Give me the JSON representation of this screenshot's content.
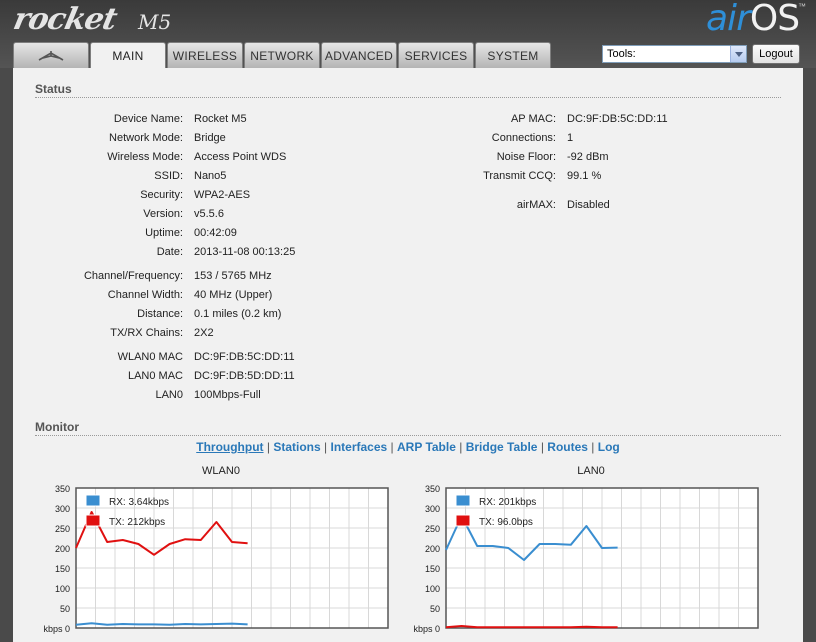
{
  "header": {
    "brand": "rocket",
    "model": "M5",
    "os_logo_a": "air",
    "os_logo_b": "OS",
    "os_tm": "™"
  },
  "tabs": [
    {
      "label": ""
    },
    {
      "label": "MAIN"
    },
    {
      "label": "WIRELESS"
    },
    {
      "label": "NETWORK"
    },
    {
      "label": "ADVANCED"
    },
    {
      "label": "SERVICES"
    },
    {
      "label": "SYSTEM"
    }
  ],
  "tools": {
    "selected": "Tools:"
  },
  "logout_label": "Logout",
  "status": {
    "title": "Status",
    "left": [
      {
        "label": "Device Name:",
        "value": "Rocket M5"
      },
      {
        "label": "Network Mode:",
        "value": "Bridge"
      },
      {
        "label": "Wireless Mode:",
        "value": "Access Point WDS"
      },
      {
        "label": "SSID:",
        "value": "Nano5"
      },
      {
        "label": "Security:",
        "value": "WPA2-AES"
      },
      {
        "label": "Version:",
        "value": "v5.5.6"
      },
      {
        "label": "Uptime:",
        "value": "00:42:09"
      },
      {
        "label": "Date:",
        "value": "2013-11-08 00:13:25"
      },
      {
        "label": "Channel/Frequency:",
        "value": "153 / 5765 MHz"
      },
      {
        "label": "Channel Width:",
        "value": "40 MHz (Upper)"
      },
      {
        "label": "Distance:",
        "value": "0.1 miles (0.2 km)"
      },
      {
        "label": "TX/RX Chains:",
        "value": "2X2"
      },
      {
        "label": "WLAN0 MAC",
        "value": "DC:9F:DB:5C:DD:11"
      },
      {
        "label": "LAN0 MAC",
        "value": "DC:9F:DB:5D:DD:11"
      },
      {
        "label": "LAN0",
        "value": "100Mbps-Full"
      }
    ],
    "right": [
      {
        "label": "AP MAC:",
        "value": "DC:9F:DB:5C:DD:11"
      },
      {
        "label": "Connections:",
        "value": "1"
      },
      {
        "label": "Noise Floor:",
        "value": "-92 dBm"
      },
      {
        "label": "Transmit CCQ:",
        "value": "99.1 %"
      },
      {
        "label": "airMAX:",
        "value": "Disabled"
      }
    ]
  },
  "monitor": {
    "title": "Monitor",
    "links": [
      "Throughput",
      "Stations",
      "Interfaces",
      "ARP Table",
      "Bridge Table",
      "Routes",
      "Log"
    ],
    "active_link": "Throughput"
  },
  "chart_data": [
    {
      "type": "line",
      "title": "WLAN0",
      "ylabel": "kbps",
      "ylim": [
        0,
        350
      ],
      "yticks": [
        0,
        50,
        100,
        150,
        200,
        250,
        300,
        350
      ],
      "grid": true,
      "legend": "top-left",
      "series": [
        {
          "name": "RX: 3.64kbps",
          "color": "#3a8ed0",
          "values": [
            8,
            12,
            8,
            10,
            9,
            9,
            8,
            10,
            9,
            10,
            11,
            9
          ]
        },
        {
          "name": "TX: 212kbps",
          "color": "#e01010",
          "values": [
            200,
            290,
            215,
            220,
            210,
            183,
            210,
            222,
            220,
            265,
            215,
            212
          ]
        }
      ]
    },
    {
      "type": "line",
      "title": "LAN0",
      "ylabel": "kbps",
      "ylim": [
        0,
        350
      ],
      "yticks": [
        0,
        50,
        100,
        150,
        200,
        250,
        300,
        350
      ],
      "grid": true,
      "legend": "top-left",
      "series": [
        {
          "name": "RX: 201kbps",
          "color": "#3a8ed0",
          "values": [
            195,
            280,
            205,
            205,
            200,
            170,
            210,
            210,
            208,
            255,
            200,
            201
          ]
        },
        {
          "name": "TX: 96.0bps",
          "color": "#e01010",
          "values": [
            2,
            5,
            2,
            2,
            2,
            2,
            2,
            2,
            2,
            3,
            2,
            2
          ]
        }
      ]
    }
  ]
}
